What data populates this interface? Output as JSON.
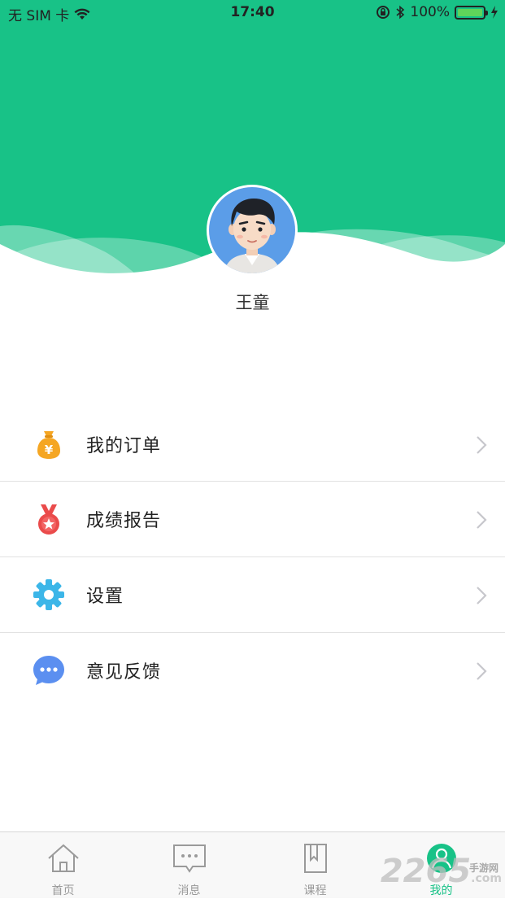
{
  "status_bar": {
    "carrier": "无 SIM 卡",
    "time": "17:40",
    "battery": "100%"
  },
  "profile": {
    "name": "王童"
  },
  "menu": {
    "items": [
      {
        "label": "我的订单",
        "icon": "money-bag-icon"
      },
      {
        "label": "成绩报告",
        "icon": "medal-icon"
      },
      {
        "label": "设置",
        "icon": "gear-icon"
      },
      {
        "label": "意见反馈",
        "icon": "chat-bubble-icon"
      }
    ]
  },
  "tabbar": {
    "tabs": [
      {
        "label": "首页",
        "icon": "home-icon",
        "active": false
      },
      {
        "label": "消息",
        "icon": "message-icon",
        "active": false
      },
      {
        "label": "课程",
        "icon": "bookmark-icon",
        "active": false
      },
      {
        "label": "我的",
        "icon": "user-icon",
        "active": true
      }
    ]
  },
  "watermark": {
    "number": "2265",
    "suffix": "手游网",
    "domain": ".com"
  },
  "colors": {
    "brand_green": "#18c287",
    "avatar_blue": "#5b9de8",
    "orange": "#f5a623",
    "red": "#ea4b4b",
    "gear_blue": "#3cb6e8",
    "chat_blue": "#5b8ff0"
  }
}
